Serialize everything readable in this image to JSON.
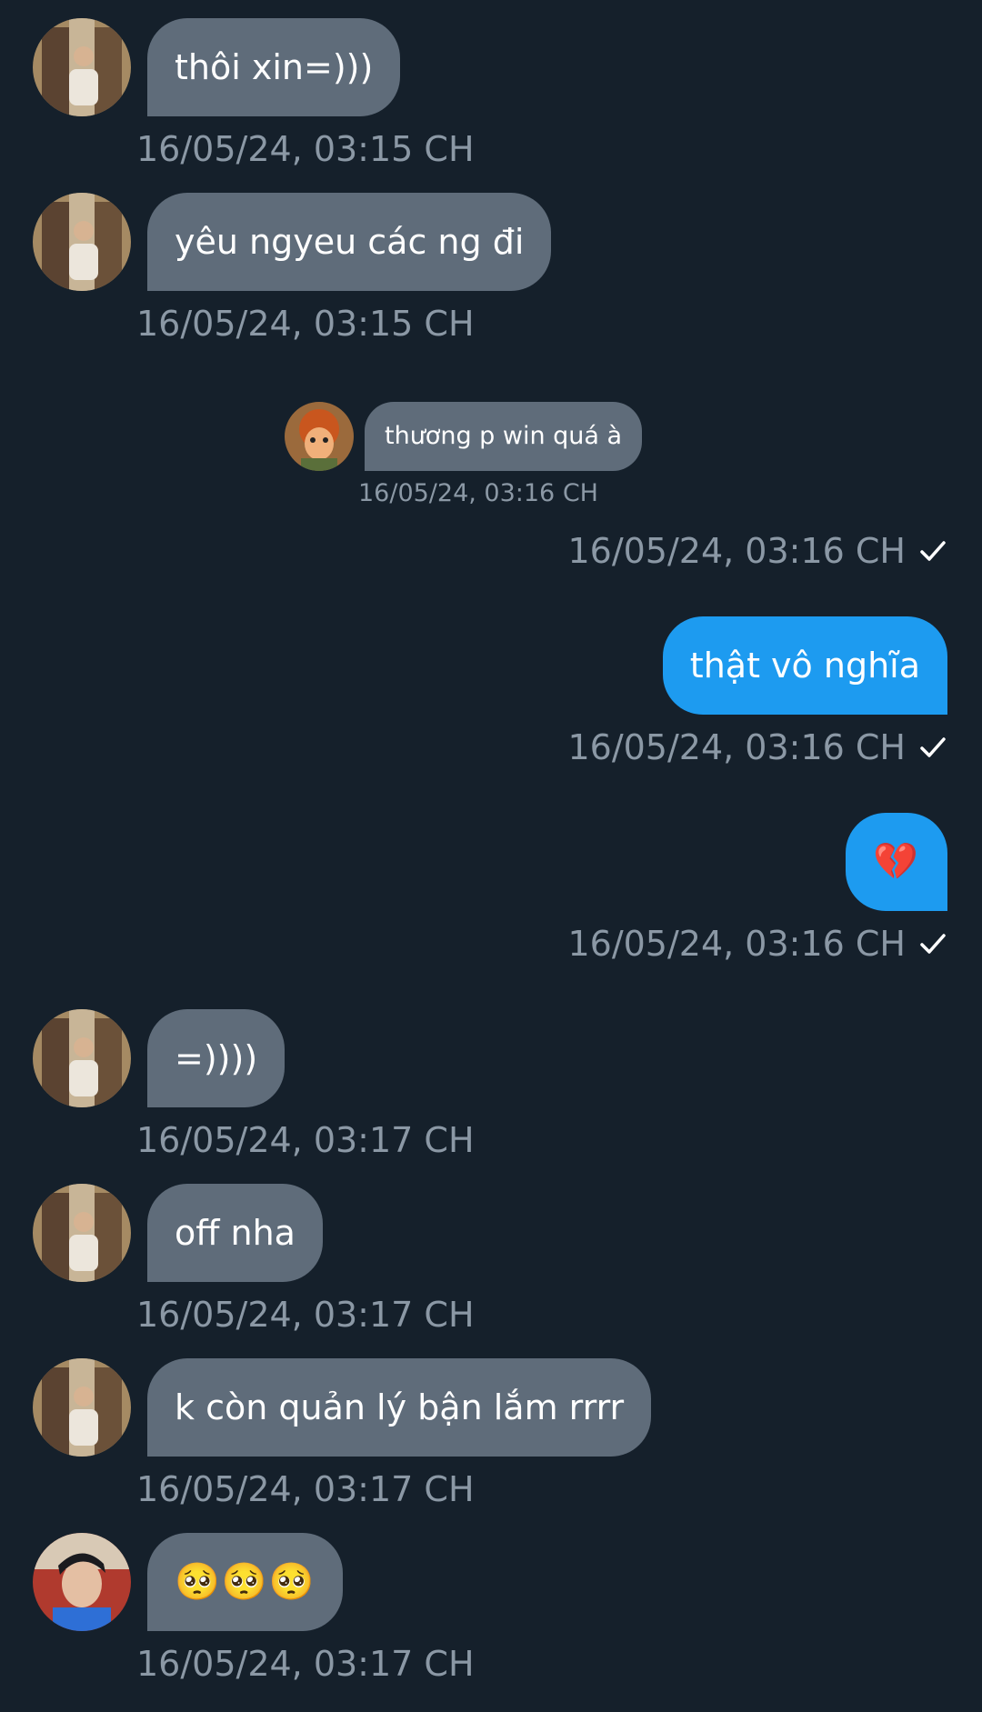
{
  "messages": [
    {
      "text": "thôi xin=)))",
      "timestamp": "16/05/24, 03:15 CH"
    },
    {
      "text": "yêu ngyeu các ng đi",
      "timestamp": "16/05/24, 03:15 CH"
    },
    {
      "quoted_text": "thương p win quá à",
      "quoted_timestamp": "16/05/24, 03:16 CH",
      "timestamp": "16/05/24, 03:16 CH"
    },
    {
      "text": "thật vô nghĩa",
      "timestamp": "16/05/24, 03:16 CH"
    },
    {
      "text": "💔",
      "timestamp": "16/05/24, 03:16 CH"
    },
    {
      "text": "=))))",
      "timestamp": "16/05/24, 03:17 CH"
    },
    {
      "text": "off nha",
      "timestamp": "16/05/24, 03:17 CH"
    },
    {
      "text": "k còn quản lý bận lắm rrrr",
      "timestamp": "16/05/24, 03:17 CH"
    },
    {
      "text": "🥺🥺🥺",
      "timestamp": "16/05/24, 03:17 CH"
    }
  ],
  "colors": {
    "background": "#15202b",
    "incoming_bubble": "#5f6c7a",
    "outgoing_bubble": "#1d9bf0",
    "timestamp": "#8b98a5"
  },
  "icons": {
    "read_receipt": "check-icon",
    "avatar": "avatar"
  }
}
